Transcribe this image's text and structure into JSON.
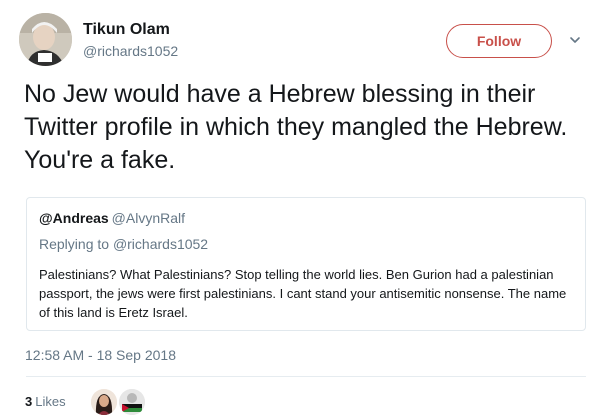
{
  "tweet": {
    "author": {
      "display_name": "Tikun Olam",
      "handle": "@richards1052"
    },
    "follow_label": "Follow",
    "text": "No Jew would have a Hebrew blessing in their Twitter profile in which they mangled the Hebrew.  You're a fake.",
    "timestamp": "12:58 AM - 18 Sep 2018",
    "likes": {
      "count": "3",
      "label": "Likes"
    }
  },
  "quoted_tweet": {
    "display_name": "@Andreas",
    "handle": "@AlvynRalf",
    "replying_prefix": "Replying to",
    "replying_to": "@richards1052",
    "text": "Palestinians? What Palestinians? Stop telling the world lies. Ben Gurion had a palestinian passport, the jews were first palestinians. I cant stand your antisemitic nonsense. The name of this land is Eretz Israel."
  },
  "icons": {
    "more": "chevron-down-icon"
  },
  "colors": {
    "follow_accent": "#c8504a",
    "secondary_text": "#657786",
    "primary_text": "#14171a",
    "border": "#e1e8ed"
  }
}
